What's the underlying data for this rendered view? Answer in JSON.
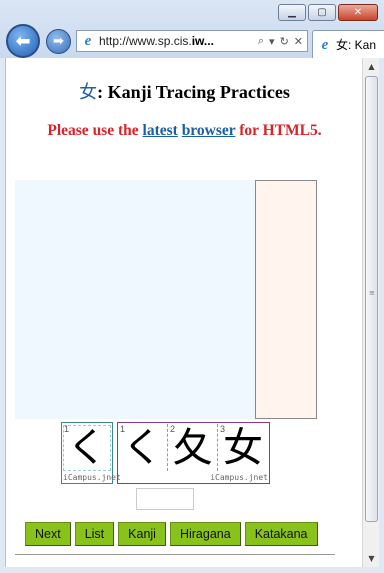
{
  "browser": {
    "url_prefix": "http://www.sp.cis.",
    "url_bold": "iw...",
    "tab_title": "女: Kan",
    "window_buttons": [
      "minimize",
      "maximize",
      "close"
    ]
  },
  "page": {
    "title_kanji": "女",
    "title_text": ": Kanji Tracing Practices",
    "notice_prefix": "Please use the ",
    "notice_link1": "latest",
    "notice_link2": "browser",
    "notice_suffix": " for HTML5."
  },
  "stroke_order": {
    "single": {
      "number": "1",
      "glyph": "く"
    },
    "sequence": [
      {
        "number": "1",
        "glyph": "く"
      },
      {
        "number": "2",
        "glyph": "夂"
      },
      {
        "number": "3",
        "glyph": "女"
      }
    ],
    "credit": "iCampus.jnet"
  },
  "input_value": "",
  "nav_buttons": {
    "next": "Next",
    "list": "List",
    "kanji": "Kanji",
    "hiragana": "Hiragana",
    "katakana": "Katakana"
  },
  "colors": {
    "notice_red": "#d8232a",
    "link_blue": "#1a5ea8",
    "button_green": "#8ac21c",
    "canvas_bg": "#f0f8ff",
    "panel_bg": "#fff4ee"
  }
}
